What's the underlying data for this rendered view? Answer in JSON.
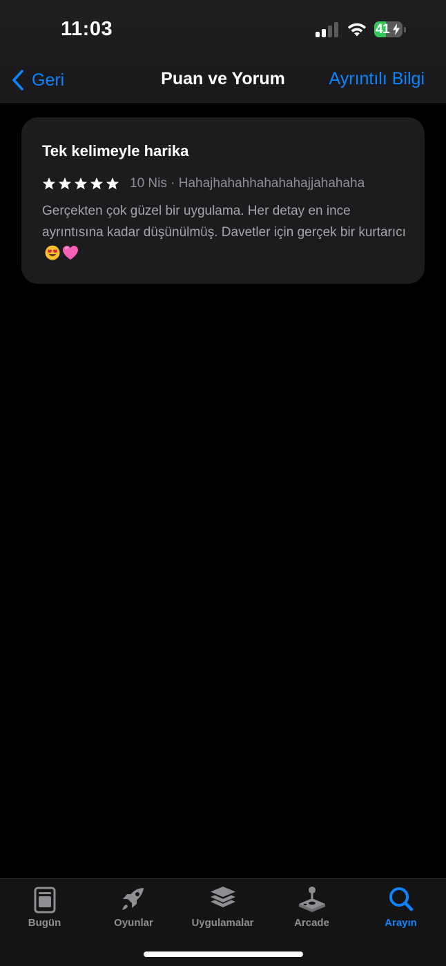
{
  "status": {
    "time": "11:03",
    "battery_percent": "41",
    "battery_level": 0.41,
    "signal_bars": 2
  },
  "nav": {
    "back_label": "Geri",
    "title": "Puan ve Yorum",
    "right_label": "Ayrıntılı Bilgi"
  },
  "review": {
    "title": "Tek kelimeyle harika",
    "rating": 5,
    "meta": "10 Nis · Hahajhahahhahahahajjahahaha",
    "body": "Gerçekten çok güzel bir uygulama. Her detay en ince ayrıntısına kadar düşünülmüş. Davetler için gerçek bir kurtarıcı",
    "emoji": [
      "smiling-face-with-heart-eyes",
      "pink-heart"
    ]
  },
  "tabs": [
    {
      "label": "Bugün",
      "icon": "today-icon"
    },
    {
      "label": "Oyunlar",
      "icon": "rocket-icon"
    },
    {
      "label": "Uygulamalar",
      "icon": "apps-stack-icon"
    },
    {
      "label": "Arcade",
      "icon": "joystick-icon"
    },
    {
      "label": "Arayın",
      "icon": "search-icon"
    }
  ],
  "active_tab": "Arayın",
  "colors": {
    "accent": "#0a84ff",
    "background": "#000000",
    "card": "#1c1c1e",
    "battery": "#34c759"
  }
}
